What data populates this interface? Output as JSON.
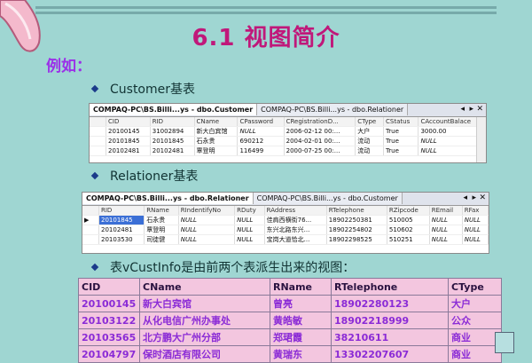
{
  "title": "6.1  视图简介",
  "example_label": "例如：",
  "bullets": {
    "customer": "Customer基表",
    "relationer": "Relationer基表",
    "view": "表vCustInfo是由前两个表派生出来的视图："
  },
  "customer_window": {
    "tabs": [
      "COMPAQ-PC\\BS.Billi...ys - dbo.Customer",
      "COMPAQ-PC\\BS.Billi...ys - dbo.Relationer"
    ],
    "columns": [
      "",
      "CID",
      "RID",
      "CName",
      "CPassword",
      "CRegistrationD...",
      "CType",
      "CStatus",
      "CAccountBalace"
    ],
    "rows": [
      [
        "",
        "20100145",
        "31002894",
        "新大白宾馆",
        "NULL",
        "2006-02-12 00:...",
        "大户",
        "True",
        "3000.00"
      ],
      [
        "",
        "20101845",
        "20101845",
        "石永贵",
        "690212",
        "2004-02-01 00:...",
        "流动",
        "True",
        "NULL"
      ],
      [
        "",
        "20102481",
        "20102481",
        "覃登明",
        "116499",
        "2000-07-25 00:...",
        "流动",
        "True",
        "NULL"
      ]
    ]
  },
  "relationer_window": {
    "tabs": [
      "COMPAQ-PC\\BS.Billi...ys - dbo.Relationer",
      "COMPAQ-PC\\BS.Billi...ys - dbo.Customer"
    ],
    "columns": [
      "",
      "RID",
      "RName",
      "RIndentifyNo",
      "RDuty",
      "RAddress",
      "RTelephone",
      "RZipcode",
      "REmail",
      "RFax"
    ],
    "rows": [
      [
        "▶",
        "20101845",
        "石永贵",
        "NULL",
        "NULL",
        "佳肩西横街76...",
        "18902250381",
        "510005",
        "NULL",
        "NULL"
      ],
      [
        "",
        "20102481",
        "覃登明",
        "NULL",
        "NULL",
        "东兴北路东兴...",
        "18902254802",
        "510602",
        "NULL",
        "NULL"
      ],
      [
        "",
        "20103530",
        "司徒健",
        "NULL",
        "NULL",
        "宝岗大道恰北...",
        "18902298525",
        "510251",
        "NULL",
        "NULL"
      ]
    ]
  },
  "view_table": {
    "columns": [
      "CID",
      "CName",
      "RName",
      "RTelephone",
      "CType"
    ],
    "rows": [
      [
        "20100145",
        "新大白宾馆",
        "曾亮",
        "18902280123",
        "大户"
      ],
      [
        "20103122",
        "从化电信广州办事处",
        "黄皓敏",
        "18902218999",
        "公众"
      ],
      [
        "20103565",
        "北方鹏大广州分部",
        "郑珺霞",
        "38210611",
        "商业"
      ],
      [
        "20104797",
        "保时酒店有限公司",
        "黄瑞东",
        "13302207607",
        "商业"
      ]
    ]
  }
}
